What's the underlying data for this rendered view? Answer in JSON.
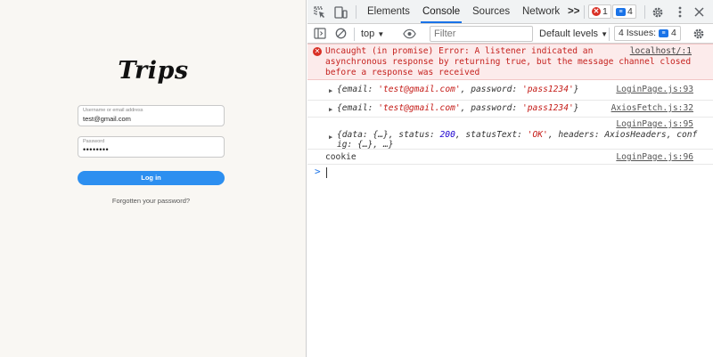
{
  "app": {
    "logo": "Trips",
    "username": {
      "label": "Username or email address",
      "value": "test@gmail.com"
    },
    "password": {
      "label": "Password",
      "value": "••••••••"
    },
    "login_button": "Log in",
    "forgot_link": "Forgotten your password?"
  },
  "devtools": {
    "tabs": [
      "Elements",
      "Console",
      "Sources",
      "Network"
    ],
    "active_tab": "Console",
    "more_tabs": ">>",
    "error_count": "1",
    "message_count": "4",
    "context": "top",
    "filter_placeholder": "Filter",
    "levels_label": "Default levels",
    "issues_label": "4 Issues:",
    "issues_count": "4",
    "accent_color": "#1a73e8",
    "error_color": "#d93025"
  },
  "console": {
    "error": {
      "text": "Uncaught (in promise) Error: A listener indicated an\nasynchronous response by returning true, but the message channel closed\nbefore a response was received",
      "source": "localhost/:1"
    },
    "log1": {
      "source": "LoginPage.js:93",
      "email_key": "email",
      "email": "'test@gmail.com'",
      "password_key": "password",
      "password": "'pass1234'"
    },
    "log2": {
      "source": "AxiosFetch.js:32",
      "email_key": "email",
      "email": "'test@gmail.com'",
      "password_key": "password",
      "password": "'pass1234'"
    },
    "log3": {
      "source": "LoginPage.js:95",
      "line1_a": "{data: {…}, status: ",
      "status": "200",
      "line1_b": ", statusText: ",
      "status_text": "'OK'",
      "line1_c": ", headers: AxiosHeaders, conf",
      "line2": "ig: {…}, …}"
    },
    "log4": {
      "text": "cookie",
      "source": "LoginPage.js:96"
    },
    "prompt": ">"
  }
}
